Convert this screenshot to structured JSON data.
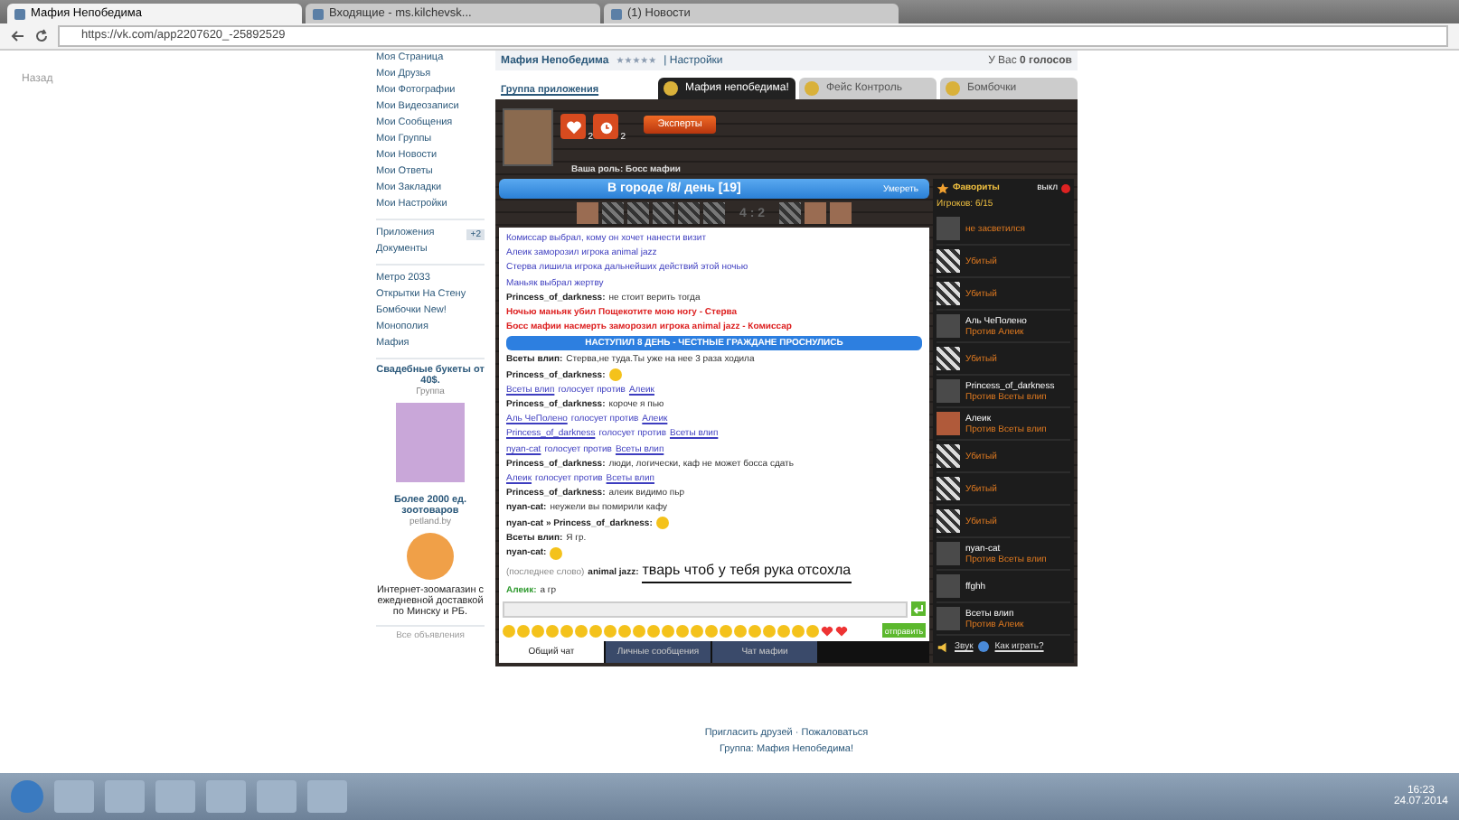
{
  "browser": {
    "tabs": [
      {
        "title": "Мафия Непобедима",
        "selected": true
      },
      {
        "title": "Входящие - ms.kilchevsk...",
        "selected": false
      },
      {
        "title": "(1) Новости",
        "selected": false
      }
    ],
    "url": "https://vk.com/app2207620_-25892529",
    "back": "Назад"
  },
  "sidebar": {
    "items": [
      {
        "label": "Моя Страница"
      },
      {
        "label": "Мои Друзья"
      },
      {
        "label": "Мои Фотографии"
      },
      {
        "label": "Мои Видеозаписи"
      },
      {
        "label": "Мои Сообщения"
      },
      {
        "label": "Мои Группы"
      },
      {
        "label": "Мои Новости"
      },
      {
        "label": "Мои Ответы"
      },
      {
        "label": "Мои Закладки"
      },
      {
        "label": "Мои Настройки"
      }
    ],
    "apps": [
      {
        "label": "Приложения",
        "badge": "+2"
      },
      {
        "label": "Документы"
      }
    ],
    "games": [
      "Метро 2033",
      "Открытки На Стену",
      "Бомбочки New!",
      "Монополия",
      "Мафия"
    ],
    "ads": [
      {
        "title": "Свадебные букеты от 40$.",
        "source": "Группа"
      },
      {
        "title": "Более 2000 ед. зоотоваров",
        "source": "petland.by",
        "text": "Интернет-зоомагазин с ежедневной доставкой по Минску и РБ."
      }
    ],
    "all_ads": "Все объявления"
  },
  "app": {
    "title": "Мафия Непобедима",
    "stars": 5,
    "settings": "| Настройки",
    "votes": "У Вас **0 голосов**",
    "group": "Группа приложения",
    "tabs": [
      {
        "label": "Мафия непобедима!",
        "selected": true
      },
      {
        "label": "Фейс Контроль",
        "selected": false
      },
      {
        "label": "Бомбочки",
        "selected": false
      }
    ],
    "boost_badges": [
      "2",
      "2"
    ],
    "experts": "Эксперты",
    "role": "Ваша роль: Босс мафии",
    "day_bar": "В городе /8/ день  [19]",
    "die": "Умереть",
    "strip": {
      "left": [
        {
          "dead": false
        },
        {
          "dead": true
        },
        {
          "dead": true
        },
        {
          "dead": true
        },
        {
          "dead": true
        },
        {
          "dead": true
        }
      ],
      "score": "4 : 2",
      "right": [
        {
          "dead": true
        },
        {
          "dead": false
        },
        {
          "dead": false
        }
      ]
    },
    "chat": [
      {
        "kind": "system",
        "text": "Комиссар выбрал, кому он хочет нанести визит"
      },
      {
        "kind": "system",
        "text": "Алеик заморозил игрока animal jazz"
      },
      {
        "kind": "system",
        "text": "Стерва лишила игрока дальнейших действий этой ночью"
      },
      {
        "kind": "system",
        "text": "Маньяк выбрал жертву"
      },
      {
        "kind": "chat",
        "name": "Princess_of_darkness:",
        "text": "не стоит верить тогда"
      },
      {
        "kind": "alert",
        "text": "Ночью маньяк убил Пощекотите мою ногу - Стерва"
      },
      {
        "kind": "alert",
        "text": "Босс мафии насмерть заморозил игрока animal jazz - Комиссар"
      },
      {
        "kind": "banner",
        "text": "НАСТУПИЛ 8 ДЕНЬ - ЧЕСТНЫЕ ГРАЖДАНЕ ПРОСНУЛИСЬ"
      },
      {
        "kind": "chat",
        "name": "Всеты влип:",
        "text": "Стерва,не туда.Ты уже на нее 3 раза ходила"
      },
      {
        "kind": "chat",
        "name": "Princess_of_darkness:",
        "emoji": true
      },
      {
        "kind": "vote",
        "voter": "Всеты влип",
        "verb": "голосует против",
        "target": "Алеик"
      },
      {
        "kind": "chat",
        "name": "Princess_of_darkness:",
        "text": "короче я пью"
      },
      {
        "kind": "vote",
        "voter": "Аль ЧеПолено",
        "verb": "голосует против",
        "target": "Алеик"
      },
      {
        "kind": "vote",
        "voter": "Princess_of_darkness",
        "verb": "голосует против",
        "target": "Всеты влип"
      },
      {
        "kind": "vote",
        "voter": "nyan-cat",
        "verb": "голосует против",
        "target": "Всеты влип"
      },
      {
        "kind": "chat",
        "name": "Princess_of_darkness:",
        "text": "люди, логически, каф не может босса сдать"
      },
      {
        "kind": "vote",
        "voter": "Алеик",
        "verb": "голосует против",
        "target": "Всеты влип"
      },
      {
        "kind": "chat",
        "name": "Princess_of_darkness:",
        "text": "алеик видимо пьр"
      },
      {
        "kind": "chat",
        "name": "nyan-cat:",
        "text": "неужели вы помирили кафу"
      },
      {
        "kind": "chat",
        "name": "nyan-cat » Princess_of_darkness:",
        "emoji": true
      },
      {
        "kind": "chat",
        "name": "Всеты влип:",
        "text": "Я гр."
      },
      {
        "kind": "chat",
        "name": "nyan-cat:",
        "emoji": true
      },
      {
        "kind": "last",
        "prefix": "(последнее слово)",
        "name": "animal jazz:",
        "text": "тварь чтоб у тебя рука отсохла"
      },
      {
        "kind": "own",
        "name": "Алеик:",
        "text": "а гр"
      }
    ],
    "send": "отправить",
    "chat_tabs": [
      {
        "label": "Общий чат",
        "selected": true
      },
      {
        "label": "Личные сообщения",
        "selected": false
      },
      {
        "label": "Чат мафии",
        "selected": false
      }
    ],
    "favorites": "Фавориты",
    "off": "выкл",
    "players_count": "Игроков: 6/15",
    "players": [
      {
        "status": "не засветился",
        "dead": false,
        "photo": false
      },
      {
        "status": "Убитый",
        "dead": true,
        "photo": false
      },
      {
        "status": "Убитый",
        "dead": true,
        "photo": false
      },
      {
        "name": "Аль ЧеПолено",
        "status": "Против Алеик",
        "dead": false,
        "photo": false
      },
      {
        "status": "Убитый",
        "dead": true,
        "photo": false
      },
      {
        "name": "Princess_of_darkness",
        "status": "Против Всеты влип",
        "dead": false,
        "photo": false
      },
      {
        "name": "Алеик",
        "status": "Против Всеты влип",
        "dead": false,
        "photo": true
      },
      {
        "status": "Убитый",
        "dead": true,
        "photo": false
      },
      {
        "status": "Убитый",
        "dead": true,
        "photo": false
      },
      {
        "status": "Убитый",
        "dead": true,
        "photo": false
      },
      {
        "name": "nyan-cat",
        "status": "Против Всеты влип",
        "dead": false,
        "photo": false
      },
      {
        "name": "ffghh",
        "dead": false,
        "photo": false
      },
      {
        "name": "Всеты влип",
        "status": "Против Алеик",
        "dead": false,
        "photo": false
      }
    ],
    "sound": "Звук",
    "how_to": "Как играть?"
  },
  "footer": {
    "links": "Пригласить друзей · Пожаловаться",
    "group": "Группа: Мафия Непобедима!"
  },
  "taskbar": {
    "time": "16:23",
    "date": "24.07.2014"
  }
}
